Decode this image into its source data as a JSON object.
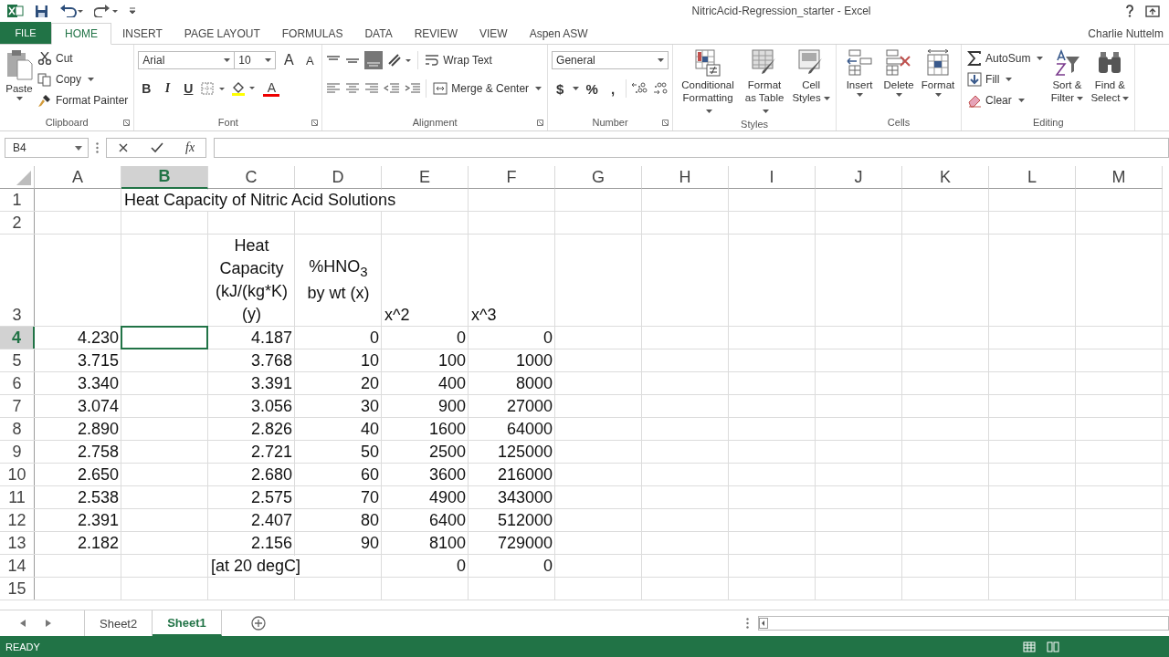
{
  "title_bar": {
    "title": "NitricAcid-Regression_starter - Excel"
  },
  "tabs": [
    {
      "label": "FILE",
      "kind": "file",
      "selected": false
    },
    {
      "label": "HOME",
      "kind": "tab",
      "selected": true
    },
    {
      "label": "INSERT",
      "kind": "tab",
      "selected": false
    },
    {
      "label": "PAGE LAYOUT",
      "kind": "tab",
      "selected": false
    },
    {
      "label": "FORMULAS",
      "kind": "tab",
      "selected": false
    },
    {
      "label": "DATA",
      "kind": "tab",
      "selected": false
    },
    {
      "label": "REVIEW",
      "kind": "tab",
      "selected": false
    },
    {
      "label": "VIEW",
      "kind": "tab",
      "selected": false
    },
    {
      "label": "Aspen ASW",
      "kind": "tab",
      "selected": false
    }
  ],
  "account": "Charlie Nuttelm",
  "ribbon": {
    "clipboard": {
      "label": "Clipboard",
      "paste": "Paste",
      "cut": "Cut",
      "copy": "Copy",
      "format_painter": "Format Painter"
    },
    "font": {
      "label": "Font",
      "font_name": "Arial",
      "font_size": "10",
      "grow": "A",
      "shrink": "A",
      "bold": "B",
      "italic": "I",
      "underline": "U",
      "font_color": "A"
    },
    "alignment": {
      "label": "Alignment",
      "wrap_text": "Wrap Text",
      "merge_center": "Merge & Center"
    },
    "number": {
      "label": "Number",
      "format": "General",
      "currency": "$",
      "percent": "%",
      "comma": ","
    },
    "styles": {
      "label": "Styles",
      "conditional": "Conditional Formatting",
      "format_table": "Format as Table",
      "cell_styles": "Cell Styles"
    },
    "cells": {
      "label": "Cells",
      "insert": "Insert",
      "delete": "Delete",
      "format": "Format"
    },
    "editing": {
      "label": "Editing",
      "autosum": "AutoSum",
      "fill": "Fill",
      "clear": "Clear",
      "sort": "Sort & Filter",
      "find": "Find & Select"
    }
  },
  "formula_bar": {
    "name_box": "B4",
    "fx": "fx"
  },
  "sheet": {
    "columns": [
      {
        "label": "A",
        "selected": false
      },
      {
        "label": "B",
        "selected": true
      },
      {
        "label": "C",
        "selected": false
      },
      {
        "label": "D",
        "selected": false
      },
      {
        "label": "E",
        "selected": false
      },
      {
        "label": "F",
        "selected": false
      },
      {
        "label": "G",
        "selected": false
      },
      {
        "label": "H",
        "selected": false
      },
      {
        "label": "I",
        "selected": false
      },
      {
        "label": "J",
        "selected": false
      },
      {
        "label": "K",
        "selected": false
      },
      {
        "label": "L",
        "selected": false
      },
      {
        "label": "M",
        "selected": false
      }
    ],
    "rows": [
      {
        "label": "1",
        "selected": false,
        "cells": [
          null,
          {
            "v": "Heat Capacity of Nitric Acid Solutions",
            "kind": "text"
          }
        ]
      },
      {
        "label": "2",
        "selected": false,
        "cells": []
      },
      {
        "label": "3",
        "selected": false,
        "cells": [
          null,
          null,
          {
            "v": "Heat Capacity (kJ/(kg*K) (y)",
            "kind": "header"
          },
          {
            "v": "%HNO$_{3}$ by wt (x)",
            "kind": "header"
          },
          {
            "v": "x^2",
            "kind": "text"
          },
          {
            "v": "x^3",
            "kind": "text"
          }
        ]
      },
      {
        "label": "4",
        "selected": true,
        "cells": [
          {
            "v": "4.230",
            "kind": "number"
          },
          null,
          {
            "v": "4.187",
            "kind": "number"
          },
          {
            "v": "0",
            "kind": "number"
          },
          {
            "v": "0",
            "kind": "number"
          },
          {
            "v": "0",
            "kind": "number"
          }
        ]
      },
      {
        "label": "5",
        "selected": false,
        "cells": [
          {
            "v": "3.715",
            "kind": "number"
          },
          null,
          {
            "v": "3.768",
            "kind": "number"
          },
          {
            "v": "10",
            "kind": "number"
          },
          {
            "v": "100",
            "kind": "number"
          },
          {
            "v": "1000",
            "kind": "number"
          }
        ]
      },
      {
        "label": "6",
        "selected": false,
        "cells": [
          {
            "v": "3.340",
            "kind": "number"
          },
          null,
          {
            "v": "3.391",
            "kind": "number"
          },
          {
            "v": "20",
            "kind": "number"
          },
          {
            "v": "400",
            "kind": "number"
          },
          {
            "v": "8000",
            "kind": "number"
          }
        ]
      },
      {
        "label": "7",
        "selected": false,
        "cells": [
          {
            "v": "3.074",
            "kind": "number"
          },
          null,
          {
            "v": "3.056",
            "kind": "number"
          },
          {
            "v": "30",
            "kind": "number"
          },
          {
            "v": "900",
            "kind": "number"
          },
          {
            "v": "27000",
            "kind": "number"
          }
        ]
      },
      {
        "label": "8",
        "selected": false,
        "cells": [
          {
            "v": "2.890",
            "kind": "number"
          },
          null,
          {
            "v": "2.826",
            "kind": "number"
          },
          {
            "v": "40",
            "kind": "number"
          },
          {
            "v": "1600",
            "kind": "number"
          },
          {
            "v": "64000",
            "kind": "number"
          }
        ]
      },
      {
        "label": "9",
        "selected": false,
        "cells": [
          {
            "v": "2.758",
            "kind": "number"
          },
          null,
          {
            "v": "2.721",
            "kind": "number"
          },
          {
            "v": "50",
            "kind": "number"
          },
          {
            "v": "2500",
            "kind": "number"
          },
          {
            "v": "125000",
            "kind": "number"
          }
        ]
      },
      {
        "label": "10",
        "selected": false,
        "cells": [
          {
            "v": "2.650",
            "kind": "number"
          },
          null,
          {
            "v": "2.680",
            "kind": "number"
          },
          {
            "v": "60",
            "kind": "number"
          },
          {
            "v": "3600",
            "kind": "number"
          },
          {
            "v": "216000",
            "kind": "number"
          }
        ]
      },
      {
        "label": "11",
        "selected": false,
        "cells": [
          {
            "v": "2.538",
            "kind": "number"
          },
          null,
          {
            "v": "2.575",
            "kind": "number"
          },
          {
            "v": "70",
            "kind": "number"
          },
          {
            "v": "4900",
            "kind": "number"
          },
          {
            "v": "343000",
            "kind": "number"
          }
        ]
      },
      {
        "label": "12",
        "selected": false,
        "cells": [
          {
            "v": "2.391",
            "kind": "number"
          },
          null,
          {
            "v": "2.407",
            "kind": "number"
          },
          {
            "v": "80",
            "kind": "number"
          },
          {
            "v": "6400",
            "kind": "number"
          },
          {
            "v": "512000",
            "kind": "number"
          }
        ]
      },
      {
        "label": "13",
        "selected": false,
        "cells": [
          {
            "v": "2.182",
            "kind": "number"
          },
          null,
          {
            "v": "2.156",
            "kind": "number"
          },
          {
            "v": "90",
            "kind": "number"
          },
          {
            "v": "8100",
            "kind": "number"
          },
          {
            "v": "729000",
            "kind": "number"
          }
        ]
      },
      {
        "label": "14",
        "selected": false,
        "cells": [
          null,
          null,
          {
            "v": "[at 20 degC]",
            "kind": "text"
          },
          null,
          {
            "v": "0",
            "kind": "number"
          },
          {
            "v": "0",
            "kind": "number"
          }
        ]
      },
      {
        "label": "15",
        "selected": false,
        "cells": []
      }
    ]
  },
  "sheet_tabs": [
    {
      "label": "Sheet2",
      "selected": false
    },
    {
      "label": "Sheet1",
      "selected": true
    }
  ],
  "status": "READY"
}
